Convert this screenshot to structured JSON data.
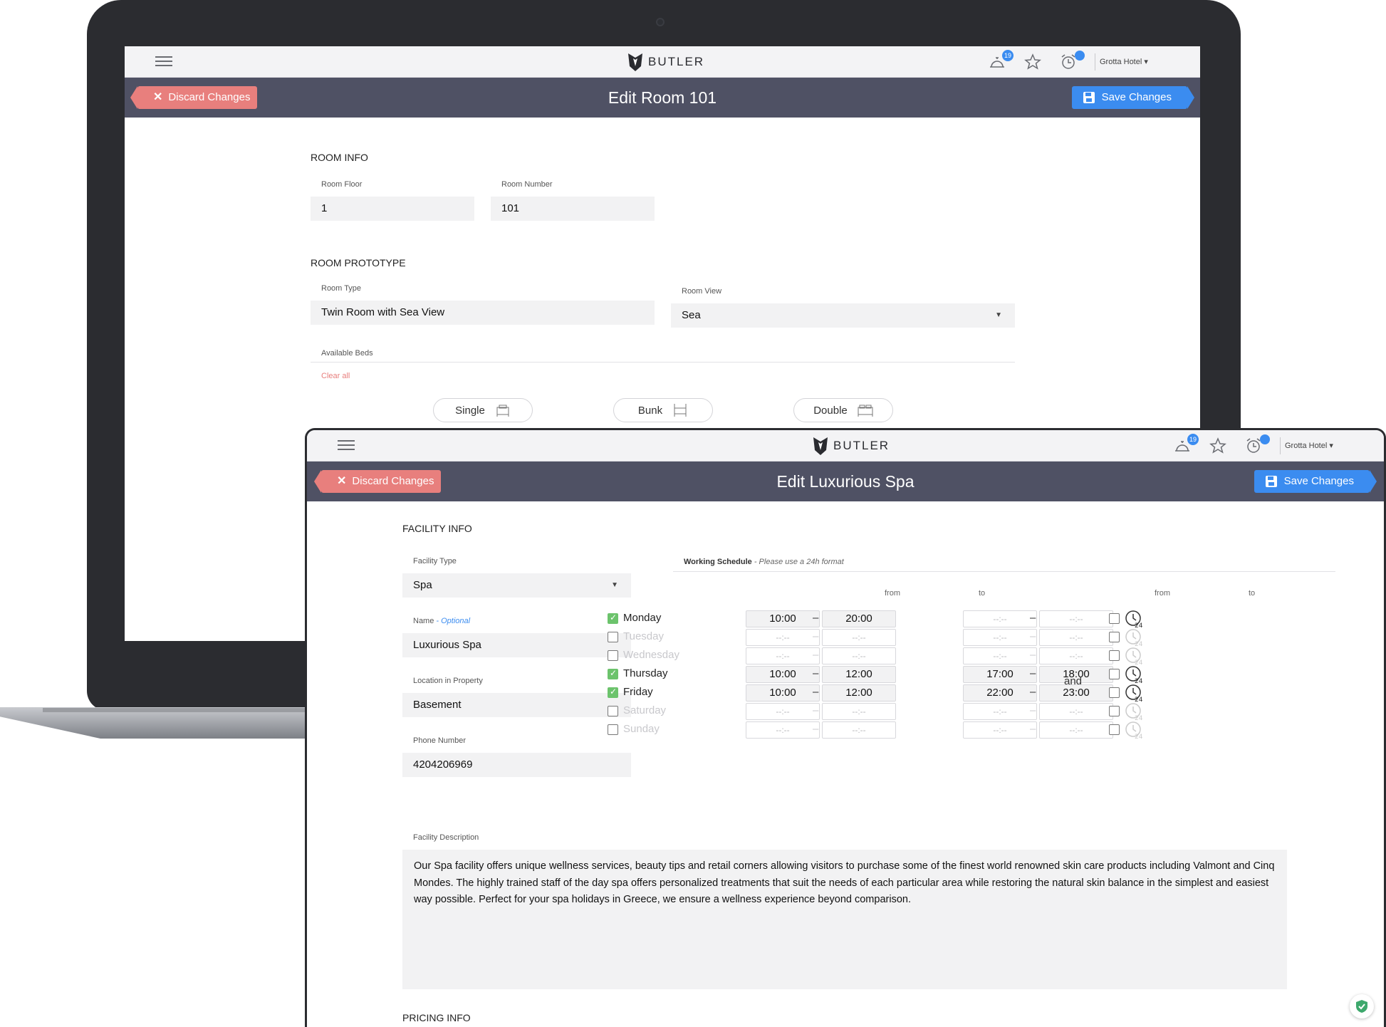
{
  "shared": {
    "brand": "BUTLER",
    "hotel": "Grotta Hotel ▾",
    "notifications_count": "19",
    "discard_label": "Discard Changes",
    "save_label": "Save Changes",
    "accent_color": "#3b8cf0",
    "discard_color": "#e87f7d",
    "header_color": "#4f5164"
  },
  "room": {
    "title": "Edit Room 101",
    "room_info_heading": "ROOM INFO",
    "floor_label": "Room Floor",
    "floor_value": "1",
    "number_label": "Room Number",
    "number_value": "101",
    "prototype_heading": "ROOM PROTOTYPE",
    "type_label": "Room Type",
    "type_value": "Twin Room with Sea View",
    "view_label": "Room View",
    "view_value": "Sea",
    "beds_label": "Available Beds",
    "clear_all": "Clear all",
    "beds": [
      "Single",
      "Bunk",
      "Double"
    ]
  },
  "facility": {
    "title": "Edit Luxurious Spa",
    "info_heading": "FACILITY INFO",
    "type_label": "Facility Type",
    "type_value": "Spa",
    "name_label": "Name",
    "name_optional": "- Optional",
    "name_value": "Luxurious Spa",
    "location_label": "Location in Property",
    "location_value": "Basement",
    "phone_label": "Phone Number",
    "phone_value": "4204206969",
    "schedule_label": "Working Schedule",
    "schedule_hint": "- Please use a 24h format",
    "from_label": "from",
    "to_label": "to",
    "and_label": "and",
    "empty_time": "--:--",
    "days": [
      {
        "name": "Monday",
        "checked": true,
        "from1": "10:00",
        "to1": "20:00",
        "from2": "",
        "to2": "",
        "all_day": false
      },
      {
        "name": "Tuesday",
        "checked": false,
        "from1": "",
        "to1": "",
        "from2": "",
        "to2": "",
        "all_day": false
      },
      {
        "name": "Wednesday",
        "checked": false,
        "from1": "",
        "to1": "",
        "from2": "",
        "to2": "",
        "all_day": false
      },
      {
        "name": "Thursday",
        "checked": true,
        "from1": "10:00",
        "to1": "12:00",
        "from2": "17:00",
        "to2": "18:00",
        "all_day": false
      },
      {
        "name": "Friday",
        "checked": true,
        "from1": "10:00",
        "to1": "12:00",
        "from2": "22:00",
        "to2": "23:00",
        "all_day": false
      },
      {
        "name": "Saturday",
        "checked": false,
        "from1": "",
        "to1": "",
        "from2": "",
        "to2": "",
        "all_day": false
      },
      {
        "name": "Sunday",
        "checked": false,
        "from1": "",
        "to1": "",
        "from2": "",
        "to2": "",
        "all_day": false
      }
    ],
    "description_label": "Facility Description",
    "description_value": "Our Spa facility offers unique wellness services, beauty tips and retail corners allowing visitors to purchase some of the finest world renowned skin care products including Valmont and Cinq Mondes. The highly trained staff of the day spa offers personalized treatments that suit the needs of each particular area while restoring the natural skin balance in the simplest and easiest way possible. Perfect for your spa holidays in Greece, we ensure a wellness experience beyond comparison.",
    "pricing_heading": "PRICING INFO"
  }
}
